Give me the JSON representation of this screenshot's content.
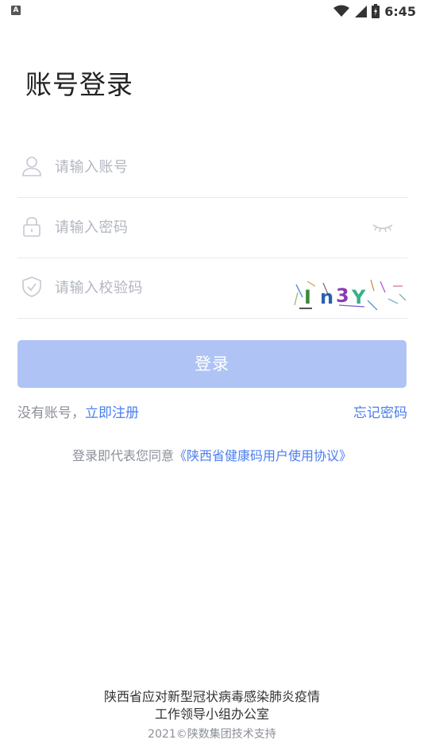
{
  "status_bar": {
    "notification_icon": "A",
    "icons": [
      "wifi-icon",
      "cellular-signal-icon",
      "battery-icon"
    ],
    "time": "6:45"
  },
  "page": {
    "title": "账号登录"
  },
  "form": {
    "account": {
      "icon": "user-icon",
      "placeholder": "请输入账号"
    },
    "password": {
      "icon": "lock-icon",
      "placeholder": "请输入密码",
      "toggle_icon": "eye-closed-icon"
    },
    "captcha": {
      "icon": "shield-check-icon",
      "placeholder": "请输入校验码",
      "captcha_text": "In3Y"
    },
    "login_button": "登录"
  },
  "links": {
    "no_account": "没有账号，",
    "register": "立即注册",
    "forgot_password": "忘记密码"
  },
  "agreement": {
    "prefix": "登录即代表您同意",
    "protocol": "《陕西省健康码用户使用协议》"
  },
  "footer": {
    "line1": "陕西省应对新型冠状病毒感染肺炎疫情",
    "line2": "工作领导小组办公室",
    "line3": "2021©陕数集团技术支持"
  },
  "colors": {
    "accent": "#4a7ef0",
    "button_disabled": "#afc3f5",
    "placeholder": "#b2b6bf",
    "muted_text": "#8b8f99"
  }
}
